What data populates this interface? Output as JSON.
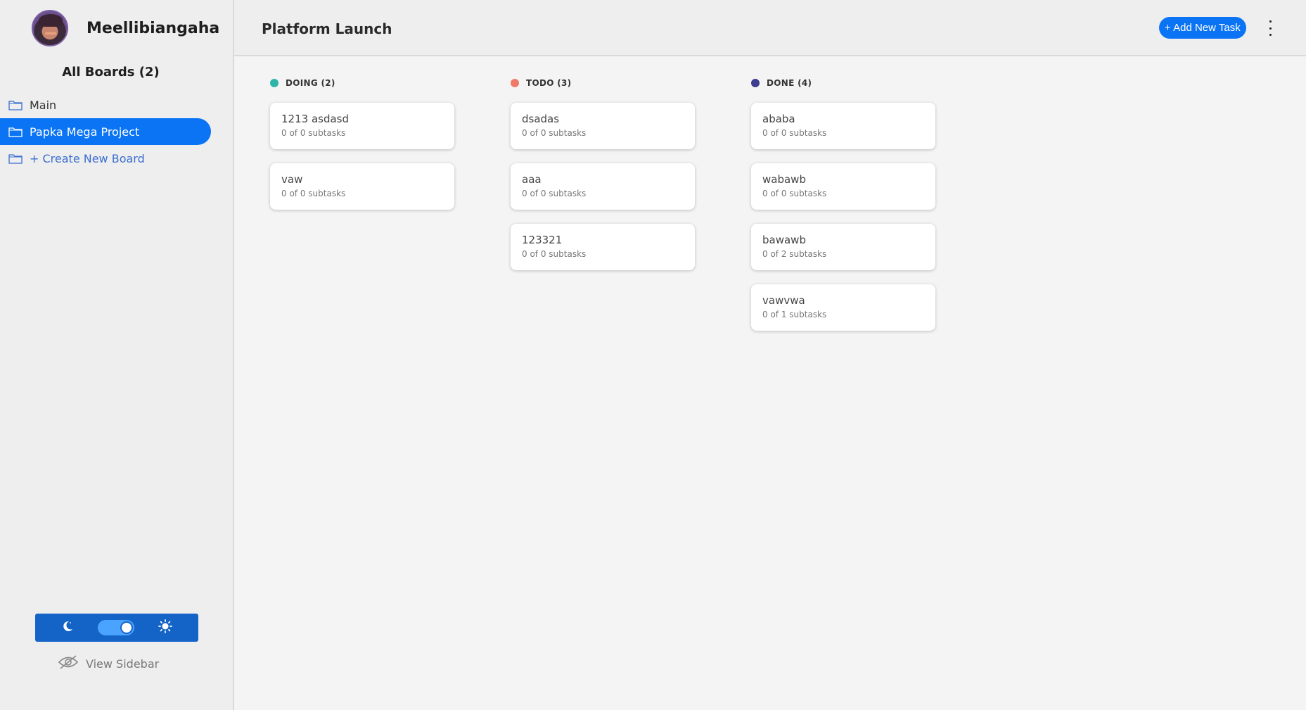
{
  "user": {
    "name": "Meellibiangaha"
  },
  "sidebar": {
    "boards_title": "All Boards (2)",
    "boards": [
      {
        "label": "Main",
        "active": false
      },
      {
        "label": "Papka Mega Project",
        "active": true
      }
    ],
    "create_label": "+ Create New Board",
    "view_sidebar_label": "View Sidebar",
    "theme": {
      "left_icon": "moon-icon",
      "right_icon": "sun-icon",
      "state": "light"
    }
  },
  "header": {
    "board_name": "Platform Launch",
    "add_task_label": "+ Add New Task"
  },
  "columns": [
    {
      "title": "DOING (2)",
      "color": "#2fb5a8",
      "cards": [
        {
          "title": "1213 asdasd",
          "subtasks": "0 of 0 subtasks"
        },
        {
          "title": "vaw",
          "subtasks": "0 of 0 subtasks"
        }
      ]
    },
    {
      "title": "TODO (3)",
      "color": "#f07a6a",
      "cards": [
        {
          "title": "dsadas",
          "subtasks": "0 of 0 subtasks"
        },
        {
          "title": "aaa",
          "subtasks": "0 of 0 subtasks"
        },
        {
          "title": "123321",
          "subtasks": "0 of 0 subtasks"
        }
      ]
    },
    {
      "title": "DONE (4)",
      "color": "#3f3d8f",
      "cards": [
        {
          "title": "ababa",
          "subtasks": "0 of 0 subtasks"
        },
        {
          "title": "wabawb",
          "subtasks": "0 of 0 subtasks"
        },
        {
          "title": "bawawb",
          "subtasks": "0 of 2 subtasks"
        },
        {
          "title": "vawvwa",
          "subtasks": "0 of 1 subtasks"
        }
      ]
    }
  ]
}
